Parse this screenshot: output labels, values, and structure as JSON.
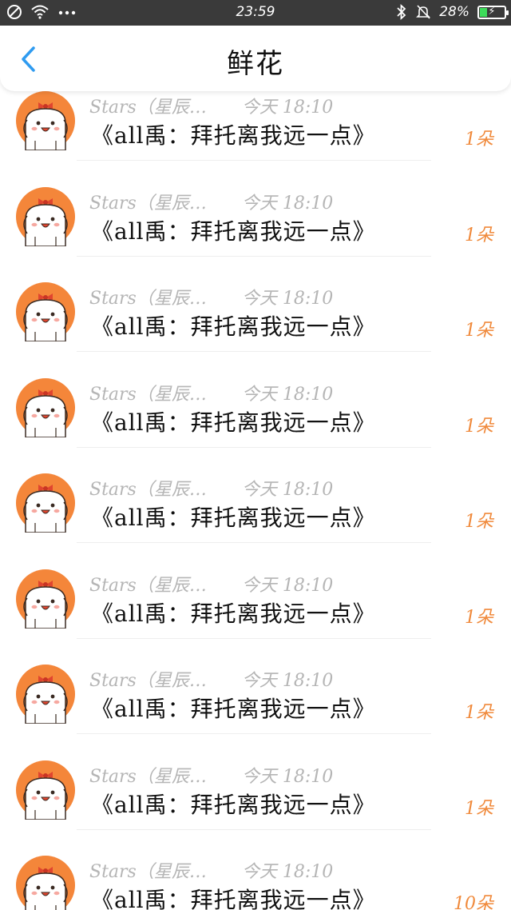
{
  "status_bar": {
    "time": "23:59",
    "battery": "28%",
    "battery_level": 0.28
  },
  "header": {
    "title": "鲜花"
  },
  "colors": {
    "accent_blue": "#2f9bf0",
    "count_orange": "#f08a3c",
    "avatar_orange": "#f4863a"
  },
  "items": [
    {
      "name": "Stars（星辰…",
      "time": "今天 18:10",
      "book": "《all禹：拜托离我远一点》",
      "count": "1朵"
    },
    {
      "name": "Stars（星辰…",
      "time": "今天 18:10",
      "book": "《all禹：拜托离我远一点》",
      "count": "1朵"
    },
    {
      "name": "Stars（星辰…",
      "time": "今天 18:10",
      "book": "《all禹：拜托离我远一点》",
      "count": "1朵"
    },
    {
      "name": "Stars（星辰…",
      "time": "今天 18:10",
      "book": "《all禹：拜托离我远一点》",
      "count": "1朵"
    },
    {
      "name": "Stars（星辰…",
      "time": "今天 18:10",
      "book": "《all禹：拜托离我远一点》",
      "count": "1朵"
    },
    {
      "name": "Stars（星辰…",
      "time": "今天 18:10",
      "book": "《all禹：拜托离我远一点》",
      "count": "1朵"
    },
    {
      "name": "Stars（星辰…",
      "time": "今天 18:10",
      "book": "《all禹：拜托离我远一点》",
      "count": "1朵"
    },
    {
      "name": "Stars（星辰…",
      "time": "今天 18:10",
      "book": "《all禹：拜托离我远一点》",
      "count": "1朵"
    },
    {
      "name": "Stars（星辰…",
      "time": "今天 18:10",
      "book": "《all禹：拜托离我远一点》",
      "count": "10朵"
    }
  ]
}
